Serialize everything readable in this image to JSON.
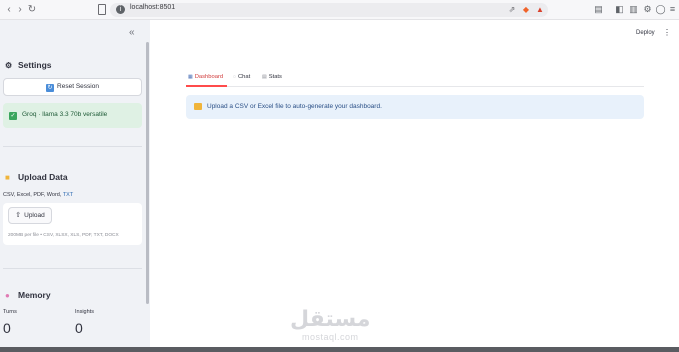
{
  "browser": {
    "url": "localhost:8501"
  },
  "sidebar": {
    "settings_title": "Settings",
    "reset_label": "Reset Session",
    "model_label": "Groq · llama 3.3 70b versatile",
    "upload_title": "Upload Data",
    "file_types_prefix": "CSV, Excel, PDF, Word, ",
    "file_types_highlight": "TXT",
    "upload_button": "Upload",
    "upload_limits": "200MB per file • CSV, XLSX, XLS, PDF, TXT, DOCX",
    "memory_title": "Memory",
    "turns_label": "Turns",
    "turns_value": "0",
    "insights_label": "Insights",
    "insights_value": "0"
  },
  "header": {
    "deploy_label": "Deploy"
  },
  "tabs": [
    {
      "label": "Dashboard",
      "active": true
    },
    {
      "label": "Chat",
      "active": false
    },
    {
      "label": "Stats",
      "active": false
    }
  ],
  "main": {
    "info_text": "Upload a CSV or Excel file to auto-generate your dashboard."
  },
  "watermark": {
    "arabic": "مستقل",
    "latin": "mostaql.com"
  },
  "colors": {
    "accent": "#ff4b4b",
    "info_bg": "#e8f1fb",
    "success_bg": "#dff1e4",
    "sidebar_bg": "#f0f2f6"
  }
}
